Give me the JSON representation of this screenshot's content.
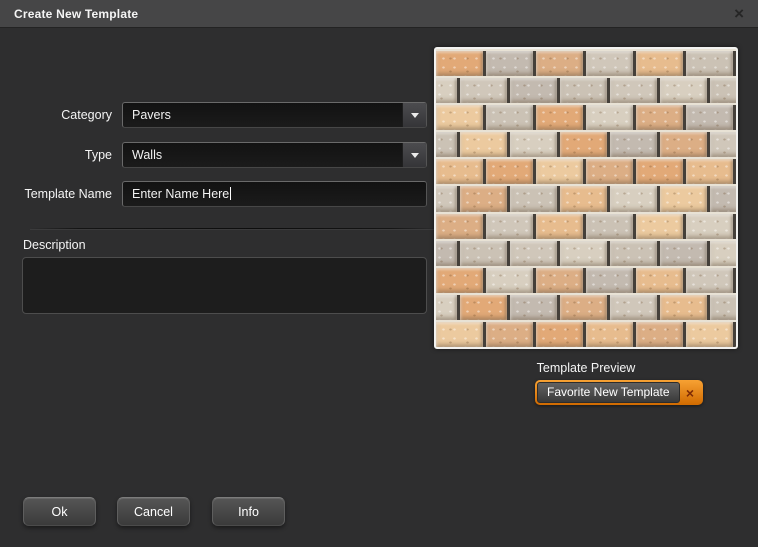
{
  "window": {
    "title": "Create New Template",
    "close_icon": "×"
  },
  "form": {
    "category": {
      "label": "Category",
      "value": "Pavers"
    },
    "type": {
      "label": "Type",
      "value": "Walls"
    },
    "template_name": {
      "label": "Template Name",
      "value": "Enter Name Here"
    },
    "description": {
      "label": "Description",
      "value": ""
    }
  },
  "preview": {
    "label": "Template Preview",
    "favorite_button": {
      "label": "Favorite New Template",
      "remove_icon": "×"
    },
    "texture": {
      "rows": 11,
      "cols": 8,
      "palette": [
        "#e2a977",
        "#d0c7ba",
        "#ecca9f",
        "#c3bab0",
        "#e7bc8e",
        "#d8cfc0",
        "#dcae85",
        "#cbc2b5"
      ],
      "mortar": "#e8e2d5",
      "joint": "#45403a"
    }
  },
  "actions": [
    {
      "label": "Ok"
    },
    {
      "label": "Cancel"
    },
    {
      "label": "Info"
    }
  ],
  "colors": {
    "titlebar": "#464647",
    "body": "#2e2e2f",
    "field_bg": "#161616",
    "accent_orange": "#e8820c"
  }
}
